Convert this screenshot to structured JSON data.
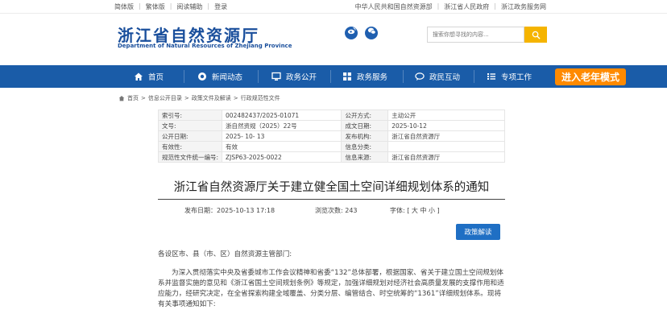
{
  "topbar": {
    "left": [
      "简体版",
      "繁体版",
      "阅读辅助",
      "登录"
    ],
    "right": [
      "中华人民共和国自然资源部",
      "浙江省人民政府",
      "浙江政务服务网"
    ]
  },
  "header": {
    "title_cn": "浙江省自然资源厅",
    "title_en": "Department of Natural Resources of Zhejiang Province",
    "search_placeholder": "搜索你想寻找的内容...",
    "social": [
      "weibo-icon",
      "wechat-icon"
    ]
  },
  "nav": {
    "items": [
      {
        "label": "首页",
        "icon": "home-icon"
      },
      {
        "label": "新闻动态",
        "icon": "news-icon"
      },
      {
        "label": "政务公开",
        "icon": "monitor-icon"
      },
      {
        "label": "政务服务",
        "icon": "service-icon"
      },
      {
        "label": "政民互动",
        "icon": "chat-icon"
      },
      {
        "label": "专项工作",
        "icon": "list-icon"
      }
    ],
    "elder_mode": "进入老年模式"
  },
  "breadcrumb": [
    "首页",
    "信息公开目录",
    "政策文件及解读",
    "行政规范性文件"
  ],
  "meta": [
    [
      "索引号:",
      "002482437/2025-01071",
      "公开方式:",
      "主动公开"
    ],
    [
      "文号:",
      "浙自然资规（2025）22号",
      "成文日期:",
      "2025-10-12"
    ],
    [
      "公开日期:",
      "2025- 10- 13",
      "发布机构:",
      "浙江省自然资源厅"
    ],
    [
      "有效性:",
      "有效",
      "信息分类:",
      ""
    ],
    [
      "规范性文件统一编号:",
      "ZJSP63-2025-0022",
      "信息来源:",
      "浙江省自然资源厅"
    ]
  ],
  "article": {
    "title": "浙江省自然资源厅关于建立健全国土空间详细规划体系的通知",
    "publish_time": "发布日期：2025-10-13 17:18",
    "views": "浏览次数: 243",
    "font_size": "字体: [ 大 中 小 ]",
    "interpret_button": "政策解读",
    "salutation": "各设区市、县（市、区）自然资源主管部门:",
    "body": "为深入贯彻落实中央及省委城市工作会议精神和省委“132”总体部署，根据国家、省关于建立国土空间规划体系并监督实施的意见和《浙江省国土空间规划条例》等规定，加强详细规划对经济社会高质量发展的支撑作用和适应能力，经研究决定，在全省探索构建全域覆盖、分类分层、编管结合、时空统筹的“1361”详细规划体系。现将有关事项通知如下:"
  }
}
